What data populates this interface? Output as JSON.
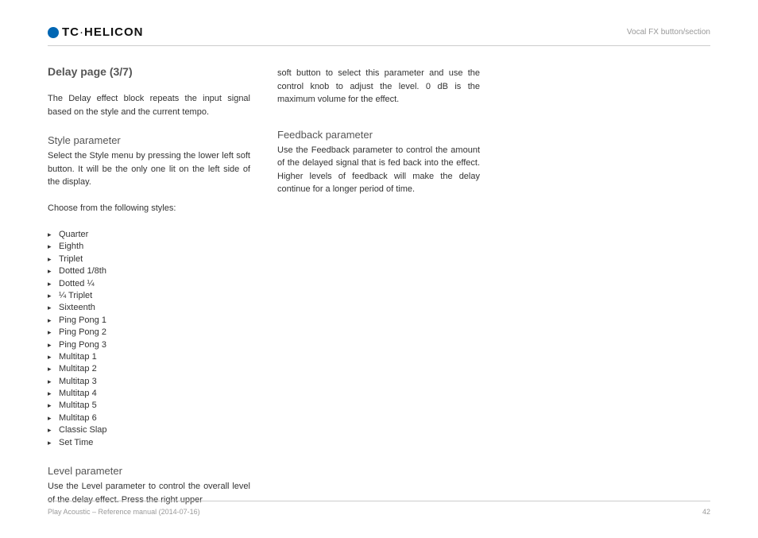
{
  "header": {
    "brand_prefix": "TC",
    "brand_suffix": "HELICON",
    "section": "Vocal FX button/section"
  },
  "title": "Delay page (3/7)",
  "intro": "The Delay effect block repeats the input signal based on the style and the current tempo.",
  "style": {
    "heading": "Style parameter",
    "text": "Select the Style menu by pressing the lower left soft button. It will be the only one lit on the left side of the display.",
    "choose": "Choose from the following styles:",
    "items": [
      "Quarter",
      "Eighth",
      "Triplet",
      "Dotted 1/8th",
      "Dotted ¼",
      "¼ Triplet",
      "Sixteenth",
      "Ping Pong 1",
      "Ping Pong 2",
      "Ping Pong 3",
      "Multitap 1",
      "Multitap 2",
      "Multitap 3",
      "Multitap 4",
      "Multitap 5",
      "Multitap 6",
      "Classic Slap",
      "Set Time"
    ]
  },
  "level": {
    "heading": "Level parameter",
    "text1": "Use the Level parameter to control the overall level of the delay effect. Press the right upper",
    "text2": "soft button to select this parameter and use the control knob to adjust the level. 0 dB is the maximum volume for the effect."
  },
  "feedback": {
    "heading": "Feedback parameter",
    "text": "Use the Feedback parameter to control the amount of the delayed signal that is fed back into the effect. Higher levels of feedback will make the delay continue for a longer period of time."
  },
  "footer": {
    "left": "Play Acoustic – Reference manual (2014-07-16)",
    "page": "42"
  }
}
